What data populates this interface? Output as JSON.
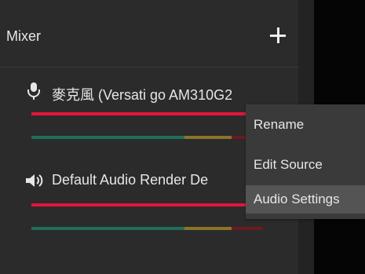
{
  "mixer": {
    "title": "Mixer",
    "add_icon": "plus-icon",
    "channels": [
      {
        "name": "麥克風 (Versati go AM310G2",
        "icon": "microphone-icon"
      },
      {
        "name": "Default Audio Render De",
        "icon": "speaker-icon"
      }
    ]
  },
  "context_menu": {
    "items": [
      {
        "label": "Rename"
      },
      {
        "label": "Edit Source"
      },
      {
        "label": "Audio Settings"
      }
    ],
    "highlighted": "Audio Settings"
  }
}
